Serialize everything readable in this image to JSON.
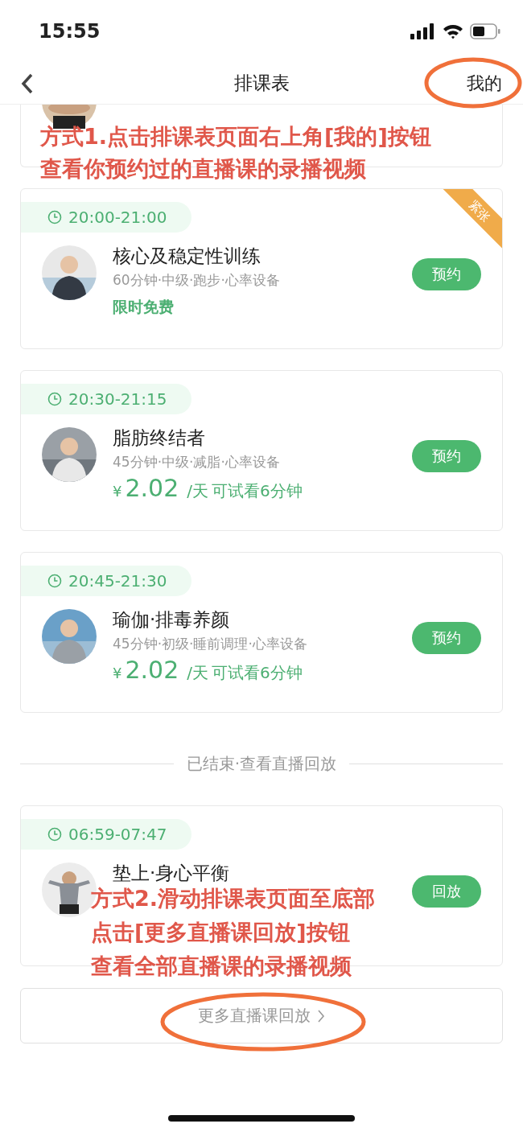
{
  "status_bar": {
    "time": "15:55"
  },
  "header": {
    "title": "排课表",
    "action": "我的"
  },
  "courses": [
    {
      "time": "20:00-21:00",
      "title": "核心及稳定性训练",
      "meta": "60分钟·中级·跑步·心率设备",
      "offer": {
        "kind": "free",
        "text": "限时免费"
      },
      "button": "预约",
      "tag": "紧张"
    },
    {
      "time": "20:30-21:15",
      "title": "脂肪终结者",
      "meta": "45分钟·中级·减脂·心率设备",
      "offer": {
        "kind": "price",
        "currency": "¥",
        "amount": "2.02",
        "unit": "/天",
        "note": "可试看6分钟"
      },
      "button": "预约"
    },
    {
      "time": "20:45-21:30",
      "title": "瑜伽·排毒养颜",
      "meta": "45分钟·初级·睡前调理·心率设备",
      "offer": {
        "kind": "price",
        "currency": "¥",
        "amount": "2.02",
        "unit": "/天",
        "note": "可试看6分钟"
      },
      "button": "预约"
    }
  ],
  "ended_divider": "已结束·查看直播回放",
  "ended_courses": [
    {
      "time": "06:59-07:47",
      "title": "垫上·身心平衡",
      "button": "回放"
    }
  ],
  "more_button": "更多直播课回放",
  "annotations": [
    {
      "lines": [
        "方式1.点击排课表页面右上角[我的]按钮",
        "查看你预约过的直播课的录播视频"
      ]
    },
    {
      "lines": [
        "方式2.滑动排课表页面至底部",
        "点击[更多直播课回放]按钮",
        "查看全部直播课的录播视频"
      ]
    }
  ]
}
